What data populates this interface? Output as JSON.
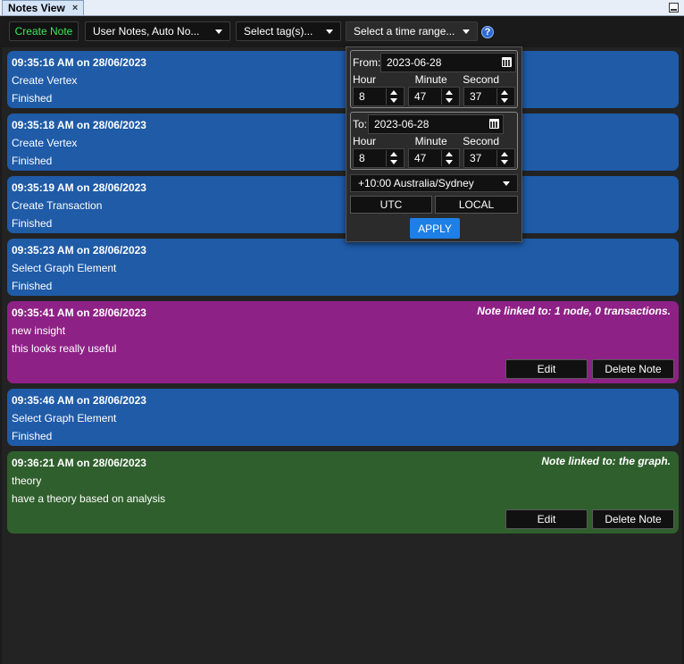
{
  "window": {
    "tab_title": "Notes View",
    "tab_close": "×"
  },
  "toolbar": {
    "create_note": "Create Note",
    "filter_type": "User Notes, Auto No...",
    "filter_tags": "Select tag(s)...",
    "time_range": "Select a time range...",
    "help": "?"
  },
  "notes": [
    {
      "time": "09:35:16 AM on 28/06/2023",
      "title": "Create Vertex",
      "body": "Finished",
      "color": "#1f5ba7"
    },
    {
      "time": "09:35:18 AM on 28/06/2023",
      "title": "Create Vertex",
      "body": "Finished",
      "color": "#1f5ba7"
    },
    {
      "time": "09:35:19 AM on 28/06/2023",
      "title": "Create Transaction",
      "body": "Finished",
      "color": "#1f5ba7"
    },
    {
      "time": "09:35:23 AM on 28/06/2023",
      "title": "Select Graph Element",
      "body": "Finished",
      "color": "#1f5ba7"
    },
    {
      "time": "09:35:41 AM on 28/06/2023",
      "title": "new insight",
      "body": "this looks really useful",
      "link": "Note linked to: 1 node, 0 transactions.",
      "edit": "Edit",
      "delete": "Delete Note",
      "color": "#8e2186"
    },
    {
      "time": "09:35:46 AM on 28/06/2023",
      "title": "Select Graph Element",
      "body": "Finished",
      "color": "#1f5ba7"
    },
    {
      "time": "09:36:21 AM on 28/06/2023",
      "title": "theory",
      "body": "have a theory based on analysis",
      "link": "Note linked to: the graph.",
      "edit": "Edit",
      "delete": "Delete Note",
      "color": "#2f5f2c"
    }
  ],
  "time_popup": {
    "from": {
      "label": "From:",
      "date": "2023-06-28",
      "hour_label": "Hour",
      "minute_label": "Minute",
      "second_label": "Second",
      "hour": "8",
      "minute": "47",
      "second": "37"
    },
    "to": {
      "label": "To:",
      "date": "2023-06-28",
      "hour_label": "Hour",
      "minute_label": "Minute",
      "second_label": "Second",
      "hour": "8",
      "minute": "47",
      "second": "37"
    },
    "timezone": "+10:00 Australia/Sydney",
    "utc": "UTC",
    "local": "LOCAL",
    "apply": "APPLY"
  }
}
